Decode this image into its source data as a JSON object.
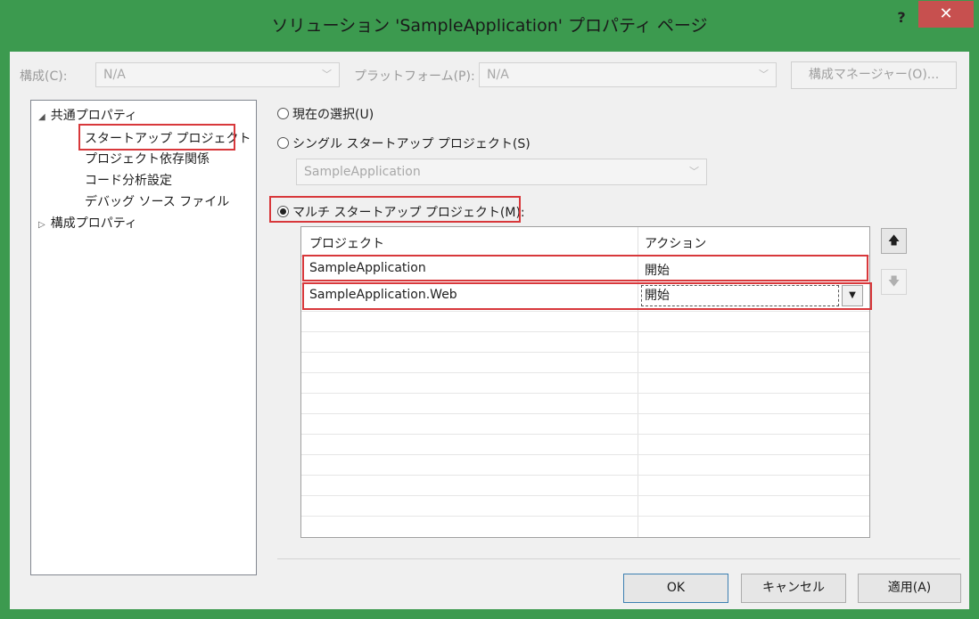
{
  "window": {
    "title": "ソリューション 'SampleApplication' プロパティ ページ",
    "help": "?",
    "close": "✕"
  },
  "toolbar": {
    "config_label": "構成(C):",
    "config_value": "N/A",
    "platform_label": "プラットフォーム(P):",
    "platform_value": "N/A",
    "config_manager": "構成マネージャー(O)..."
  },
  "tree": {
    "common": "共通プロパティ",
    "items": [
      "スタートアップ プロジェクト",
      "プロジェクト依存関係",
      "コード分析設定",
      "デバッグ ソース ファイル"
    ],
    "config_props": "構成プロパティ"
  },
  "options": {
    "current": "現在の選択(U)",
    "single": "シングル スタートアップ プロジェクト(S)",
    "single_value": "SampleApplication",
    "multi": "マルチ スタートアップ プロジェクト(M):"
  },
  "grid": {
    "headers": [
      "プロジェクト",
      "アクション"
    ],
    "rows": [
      {
        "project": "SampleApplication",
        "action": "開始"
      },
      {
        "project": "SampleApplication.Web",
        "action": "開始"
      }
    ]
  },
  "icons": {
    "up": "arrow-up-icon",
    "down": "arrow-down-icon",
    "dropdown": "chevron-down-icon"
  },
  "buttons": {
    "ok": "OK",
    "cancel": "キャンセル",
    "apply": "適用(A)"
  },
  "colors": {
    "titlebar": "#3c9a4f",
    "close": "#c7504f",
    "highlight": "#d8383b"
  }
}
